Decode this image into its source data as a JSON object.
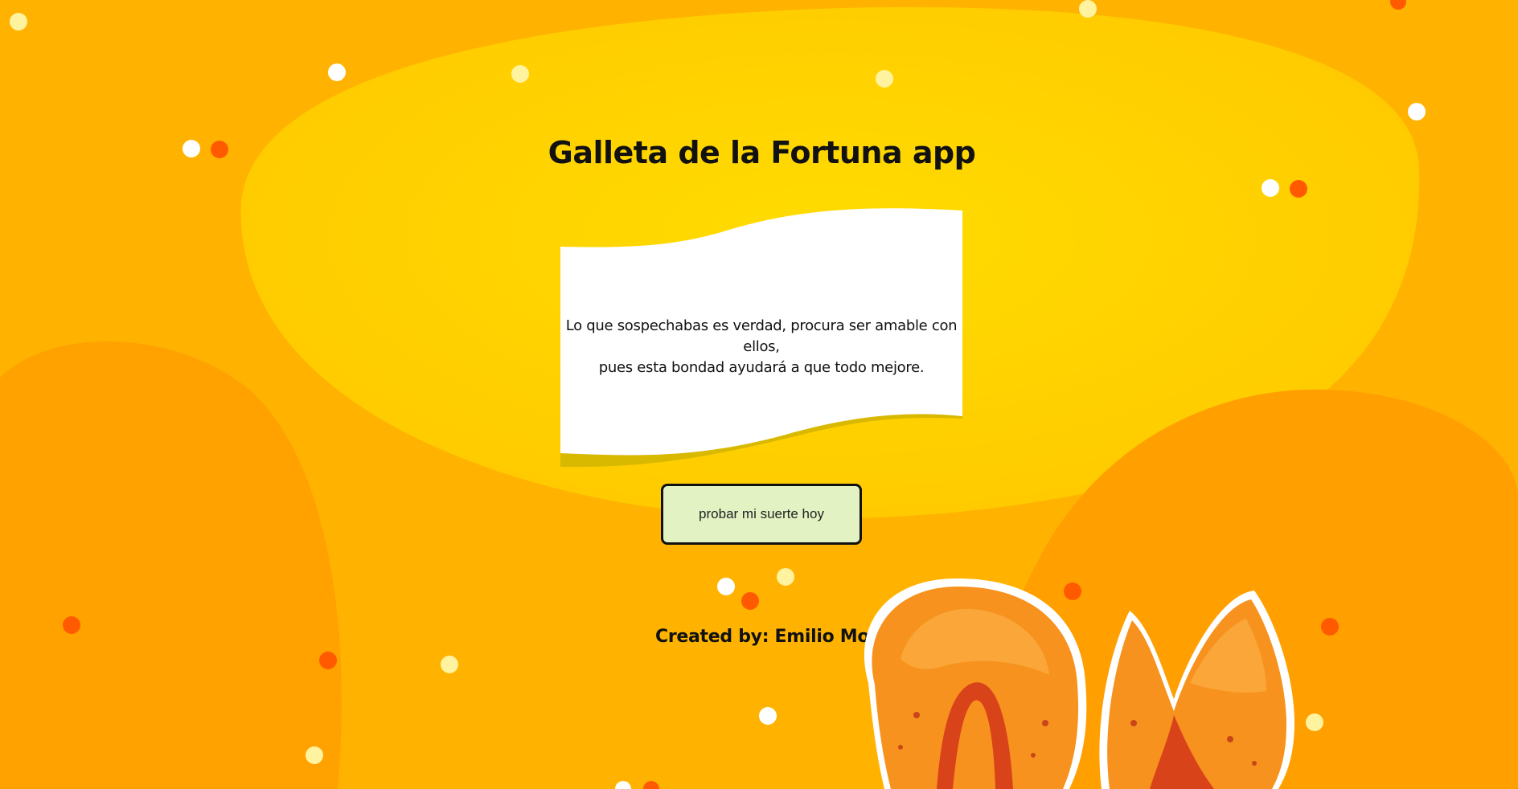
{
  "app": {
    "title": "Galleta de la Fortuna app"
  },
  "fortune": {
    "message_line1": "Lo que sospechabas es verdad, procura ser amable con ellos,",
    "message_line2": "pues esta bondad ayudará a que todo mejore."
  },
  "actions": {
    "try_luck_label": "probar mi suerte hoy"
  },
  "footer": {
    "credits": "Created by: Emilio Montero"
  },
  "colors": {
    "background": "#ffb300",
    "blob_light": "#ffd400",
    "blob_dark": "#ff9f00",
    "button_bg": "#e3f2c3",
    "paper": "#ffffff",
    "paper_shadow": "#d9b800",
    "dot_white": "#ffffff",
    "dot_cream": "#fff3a0",
    "dot_orange": "#ff5a00"
  },
  "icons": {
    "illustration": "fortune-cookie-icon"
  }
}
